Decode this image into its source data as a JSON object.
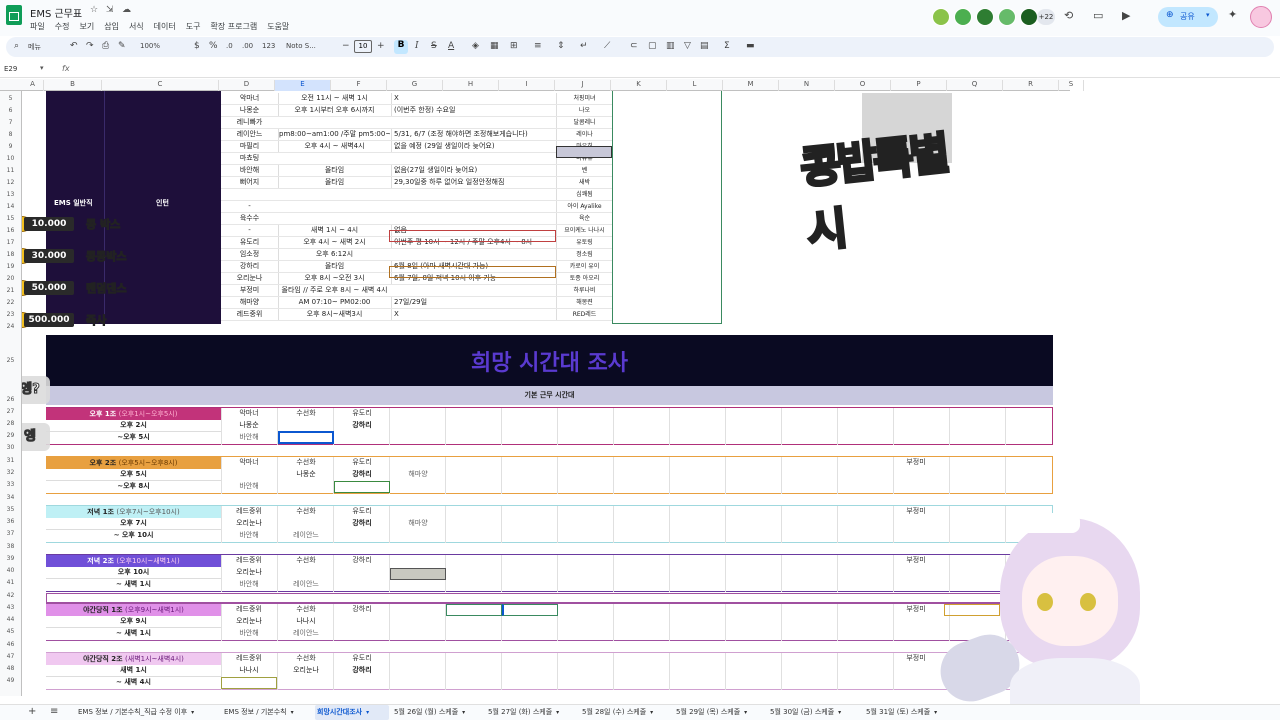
{
  "app": {
    "title": "EMS 근무표",
    "share_label": "공유",
    "avatar_extra": "+22"
  },
  "menu": [
    "파일",
    "수정",
    "보기",
    "삽입",
    "서식",
    "데이터",
    "도구",
    "확장 프로그램",
    "도움말"
  ],
  "toolbar": {
    "search": "메뉴",
    "zoom": "100%",
    "currency": "$",
    "percent": "%",
    "dec_less": ".0",
    "dec_more": ".00",
    "number_fmt": "123",
    "font": "Noto S...",
    "font_size": "10"
  },
  "formula": {
    "cellref": "E29",
    "fx": "fx"
  },
  "columns": [
    "A",
    "B",
    "C",
    "D",
    "E",
    "F",
    "G",
    "H",
    "I",
    "J",
    "K",
    "L",
    "M",
    "N",
    "O",
    "P",
    "Q",
    "R",
    "S"
  ],
  "rows": [
    "5",
    "6",
    "7",
    "8",
    "9",
    "10",
    "11",
    "12",
    "13",
    "14",
    "15",
    "16",
    "17",
    "18",
    "19",
    "20",
    "21",
    "22",
    "23",
    "24",
    "25",
    "26",
    "27",
    "28",
    "29",
    "30",
    "31",
    "32",
    "33",
    "34",
    "35",
    "36",
    "37",
    "38",
    "39",
    "40",
    "41",
    "42",
    "43",
    "44",
    "45",
    "46",
    "47",
    "48",
    "49"
  ],
  "header_block": {
    "col1": "EMS 일반직",
    "col2": "인턴"
  },
  "donations": [
    {
      "amount": "10.000",
      "label": "콩 박스"
    },
    {
      "amount": "30.000",
      "label": "콩콩박스"
    },
    {
      "amount": "50.000",
      "label": "랜덤댄스"
    },
    {
      "amount": "500.000",
      "label": "즉사"
    }
  ],
  "reactions": [
    "엥?",
    "엥"
  ],
  "schedule_rows": [
    {
      "name": "악마너",
      "time": "오전 11시 ~ 새벽 1시",
      "note": "X",
      "right": "처핑미녀"
    },
    {
      "name": "나몽순",
      "time": "오후 1시부터 오후 6시까지",
      "note": "(이번주 한정) 수요일",
      "right": "나오"
    },
    {
      "name": "레니빠가",
      "time": "",
      "note": "",
      "right": "달콤레니"
    },
    {
      "name": "레이안느",
      "time": "pm8:00~am1:00 /주말 pm5:00~am",
      "note": "5/31, 6/7 (조정 해야하면 조정해보게습니다)",
      "right": "레이나"
    },
    {
      "name": "마필리",
      "time": "오후 4시 ~ 새벽4시",
      "note": "없을 예정 (29일 생일이라 늦어요)",
      "right": "마우히"
    },
    {
      "name": "마쵸팅",
      "time": "",
      "note": "",
      "right": "마뮤뮤"
    },
    {
      "name": "바안해",
      "time": "올타임",
      "note": "없음(27일 생일이라 늦어요)",
      "right": "벤"
    },
    {
      "name": "뻐어지",
      "time": "올타임",
      "note": "29,30일중 하루 없어요 일정안정해짐",
      "right": "새박"
    },
    {
      "name": "",
      "time": "",
      "note": "",
      "right": "심쾌됨"
    },
    {
      "name": "-",
      "time": "",
      "note": "",
      "right": "아이 Ayalike"
    },
    {
      "name": "육수수",
      "time": "",
      "note": "",
      "right": "육순"
    },
    {
      "name": "-",
      "time": "새벽 1시 ~ 4시",
      "note": "없음",
      "right": "요이케노 나나시"
    },
    {
      "name": "유도리",
      "time": "오후 4시 ~ 새벽 2시",
      "note": "이번주 평 10시 ~ 12시 / 주말 오후4시 ~ 8시",
      "right": "유토링"
    },
    {
      "name": "임소정",
      "time": "오후 6:12시",
      "note": "",
      "right": "정소림"
    },
    {
      "name": "강하리",
      "time": "올타임",
      "note": "6월 8일 (아마 새벽시간대 가능)",
      "right": "카로이 유이"
    },
    {
      "name": "오리눈나",
      "time": "오후 8시 ~오전 3시",
      "note": "6월 7일, 8일 저녁 10시 이후 가능",
      "right": "토종 아오리"
    },
    {
      "name": "부정미",
      "time": "올타임 // 주로 오후 8시 ~ 새벽 4시",
      "note": "",
      "right": "하루나비"
    },
    {
      "name": "해마양",
      "time": "AM 07:10~ PM02:00",
      "note": "27일/29일",
      "right": "해몽련"
    },
    {
      "name": "레드중위",
      "time": "오후 8시~새벽3시",
      "note": "X",
      "right": "RED레드"
    }
  ],
  "banner": {
    "title": "희망 시간대 조사",
    "subtitle": "기본 근무 시간대"
  },
  "shift_groups": [
    {
      "title": "오후 1조",
      "range": "(오후1시~오후5시)",
      "line1": "오후 2시",
      "line2": "~오후 5시",
      "color": "#c2337a",
      "tcolor": "#fff",
      "rcolor": "#ffb0d0",
      "border": "#b0307a",
      "r1": [
        "악마너",
        "수선화",
        "유도리",
        "",
        "",
        "",
        "",
        "",
        "",
        ""
      ],
      "r2": [
        "나몽순",
        "",
        "강하리"
      ],
      "r3": [
        "바안해",
        "",
        ""
      ]
    },
    {
      "title": "오후 2조",
      "range": "(오후5시~오후8시)",
      "line1": "오후 5시",
      "line2": "~오후 8시",
      "color": "#e8a040",
      "tcolor": "#222",
      "rcolor": "#6b3a00",
      "border": "#e8a040",
      "r1": [
        "악마너",
        "수선화",
        "유도리",
        "",
        "",
        "",
        "",
        "",
        "부정미",
        ""
      ],
      "r2": [
        "",
        "나몽순",
        "강하리",
        "해마양"
      ],
      "r3": [
        "바안해",
        "",
        ""
      ]
    },
    {
      "title": "저녁 1조",
      "range": "(오후7시~오후10시)",
      "line1": "오후 7시",
      "line2": "~ 오후 10시",
      "color": "#bff0f5",
      "tcolor": "#222",
      "rcolor": "#555",
      "border": "#9fd8de",
      "r1": [
        "레드중위",
        "수선화",
        "유도리",
        "",
        "",
        "",
        "",
        "",
        "부정미",
        ""
      ],
      "r2": [
        "오리눈나",
        "",
        "강하리",
        "해마양"
      ],
      "r3": [
        "바안해",
        "레이안느",
        ""
      ]
    },
    {
      "title": "저녁 2조",
      "range": "(오후10시~새벽1시)",
      "line1": "오후 10시",
      "line2": "~ 새벽 1시",
      "color": "#7050d8",
      "tcolor": "#fff",
      "rcolor": "#ffd0f0",
      "border": "#6a3aa0",
      "r1": [
        "레드중위",
        "수선화",
        "강하리",
        "",
        "",
        "",
        "",
        "",
        "부정미",
        ""
      ],
      "r2": [
        "오리눈나",
        "",
        ""
      ],
      "r3": [
        "바안해",
        "레이안느",
        ""
      ]
    },
    {
      "title": "야간당직 1조",
      "range": "(오후9시~새벽1시)",
      "line1": "오후 9시",
      "line2": "~ 새벽 1시",
      "color": "#e090e8",
      "tcolor": "#222",
      "rcolor": "#6a1a7a",
      "border": "#a050a0",
      "r1": [
        "레드중위",
        "수선화",
        "강하리",
        "",
        "",
        "",
        "",
        "",
        "부정미",
        ""
      ],
      "r2": [
        "오리눈나",
        "나나시",
        ""
      ],
      "r3": [
        "바안해",
        "레이안느",
        ""
      ]
    },
    {
      "title": "야간당직 2조",
      "range": "(새벽1시~새벽4시)",
      "line1": "새벽 1시",
      "line2": "~ 새벽 4시",
      "color": "#f0c8f0",
      "tcolor": "#222",
      "rcolor": "#6a1a7a",
      "border": "#d0a0d0",
      "r1": [
        "레드중위",
        "수선화",
        "유도리",
        "",
        "",
        "",
        "",
        "",
        "부정미",
        ""
      ],
      "r2": [
        "나나시",
        "오리눈나",
        "강하리"
      ],
      "r3": [
        "",
        "",
        ""
      ]
    }
  ],
  "sheets": [
    "EMS 정보 / 기본수칙_직급 수정 이후",
    "EMS 정보 / 기본수칙",
    "희망시간대조사",
    "5월 26일 (월) 스케줄",
    "5월 27일 (화) 스케줄",
    "5월 28일 (수) 스케줄",
    "5월 29일 (목) 스케줄",
    "5월 30일 (금) 스케줄",
    "5월 31일 (토) 스케줄"
  ],
  "colors": {
    "dark_block": "#1e0f3a",
    "banner": "#0a0a22",
    "banner_text": "#5a3ad0",
    "sub_banner": "#c8c8e0",
    "accent": "#0b57d0"
  }
}
